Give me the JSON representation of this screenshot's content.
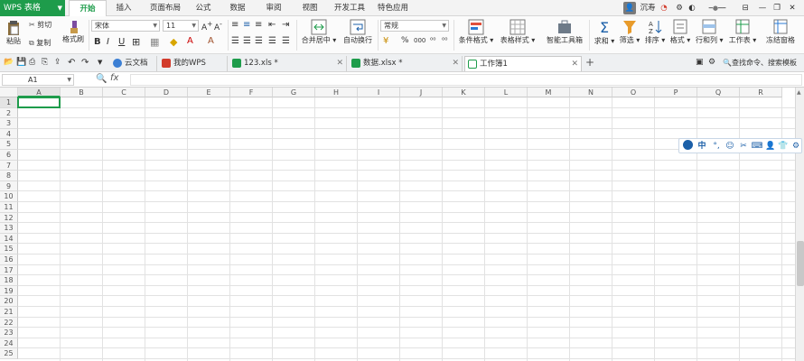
{
  "app": {
    "name": "WPS 表格",
    "active_tab": "开始"
  },
  "menu_tabs": [
    "开始",
    "插入",
    "页面布局",
    "公式",
    "数据",
    "审阅",
    "视图",
    "开发工具",
    "特色应用"
  ],
  "user": {
    "name": "沉寿"
  },
  "ribbon": {
    "paste": "粘贴",
    "cut": "剪切",
    "copy": "复制",
    "format_painter": "格式刷",
    "font_name": "宋体",
    "font_size": "11",
    "bold": "B",
    "italic": "I",
    "underline": "U",
    "merge_center": "合并居中",
    "wrap_text": "自动换行",
    "number_format": "常规",
    "percent": "%",
    "thousands": "000",
    "cond_format": "条件格式",
    "table_style": "表格样式",
    "smart_toolbox": "智能工具箱",
    "sum": "求和",
    "filter": "筛选",
    "sort": "排序",
    "format": "格式",
    "row_col": "行和列",
    "worksheet": "工作表",
    "freeze": "冻结窗格"
  },
  "doc_tabs": [
    {
      "label": "云文档",
      "color": "#3b7fd4"
    },
    {
      "label": "我的WPS",
      "color": "#d23c2c"
    },
    {
      "label": "123.xls *",
      "color": "#1e9c4b"
    },
    {
      "label": "数据.xlsx *",
      "color": "#1e9c4b"
    },
    {
      "label": "工作簿1",
      "color": "#1e9c4b",
      "active": true
    }
  ],
  "search": {
    "placeholder": "查找命令、搜索模板"
  },
  "formula_bar": {
    "name_box": "A1",
    "fx": "fx",
    "value": ""
  },
  "columns": [
    "A",
    "B",
    "C",
    "D",
    "E",
    "F",
    "G",
    "H",
    "I",
    "J",
    "K",
    "L",
    "M",
    "N",
    "O",
    "P",
    "Q",
    "R"
  ],
  "rows": [
    "1",
    "2",
    "3",
    "4",
    "5",
    "6",
    "7",
    "8",
    "9",
    "10",
    "11",
    "12",
    "13",
    "14",
    "15",
    "16",
    "17",
    "18",
    "19",
    "20",
    "21",
    "22",
    "23",
    "24",
    "25"
  ],
  "ime_bar": {
    "lang": "中"
  }
}
